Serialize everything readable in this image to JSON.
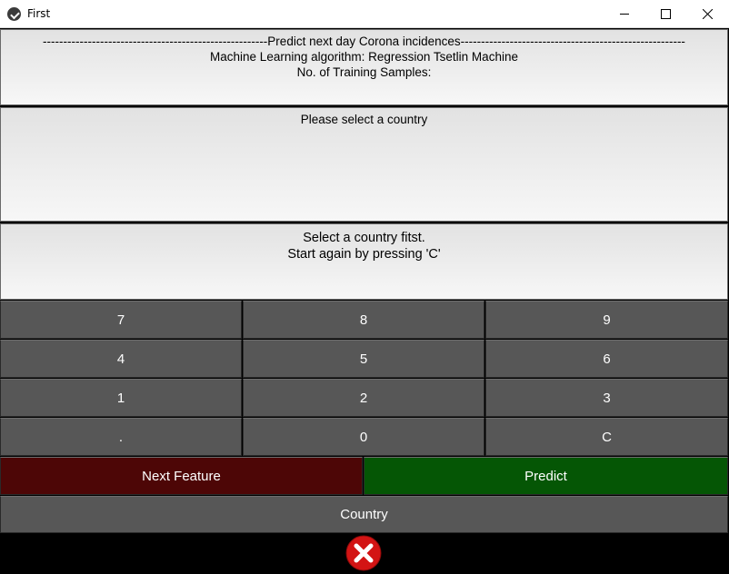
{
  "window": {
    "title": "First"
  },
  "header": {
    "line1": "-------------------------------------------------------Predict next day Corona incidences-------------------------------------------------------",
    "line2": "Machine Learning algorithm: Regression Tsetlin Machine",
    "line3": "No. of Training Samples:"
  },
  "country_panel": {
    "prompt": "Please select a country"
  },
  "message": {
    "line1": "Select a country fitst.",
    "line2": "Start again by pressing 'C'"
  },
  "keypad": {
    "rows": [
      [
        "7",
        "8",
        "9"
      ],
      [
        "4",
        "5",
        "6"
      ],
      [
        "1",
        "2",
        "3"
      ],
      [
        ".",
        "0",
        "C"
      ]
    ]
  },
  "actions": {
    "next_feature": "Next Feature",
    "predict": "Predict",
    "country": "Country"
  },
  "colors": {
    "key_bg": "#575757",
    "next_feature_bg": "#4d0606",
    "predict_bg": "#055605",
    "cancel_icon": "#d31414"
  },
  "icons": {
    "cancel": "cancel-icon"
  }
}
